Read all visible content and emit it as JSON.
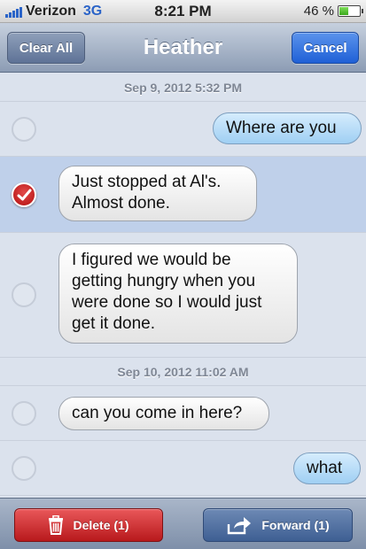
{
  "status_bar": {
    "carrier": "Verizon",
    "network": "3G",
    "time": "8:21 PM",
    "battery": "46 %",
    "battery_level": 0.46
  },
  "nav": {
    "title": "Heather",
    "clear_all_label": "Clear All",
    "cancel_label": "Cancel"
  },
  "thread": {
    "timestamp_1": "Sep 9, 2012 5:32 PM",
    "timestamp_2": "Sep 10, 2012 11:02 AM",
    "messages": [
      {
        "text": "Where are you",
        "direction": "outgoing",
        "selected": false
      },
      {
        "text": "Just stopped at Al's. Almost done.",
        "direction": "incoming",
        "selected": true
      },
      {
        "text": "I figured we would be getting hungry when you were done so I would just get it done.",
        "direction": "incoming",
        "selected": false
      },
      {
        "text": "can you come in here?",
        "direction": "incoming",
        "selected": false
      },
      {
        "text": "what",
        "direction": "outgoing",
        "selected": false
      }
    ]
  },
  "toolbar": {
    "delete_label": "Delete (1)",
    "forward_label": "Forward (1)"
  },
  "colors": {
    "incoming_bubble": "#f2f2f2",
    "outgoing_bubble": "#b8dcf8",
    "selected_row": "#bfd0ea",
    "delete_button": "#c8282b",
    "forward_button": "#4d6c9e",
    "cancel_button": "#2a6ce0"
  },
  "icons": [
    "signal-bars-icon",
    "battery-icon",
    "checkmark-icon",
    "trash-icon",
    "forward-arrow-icon"
  ]
}
